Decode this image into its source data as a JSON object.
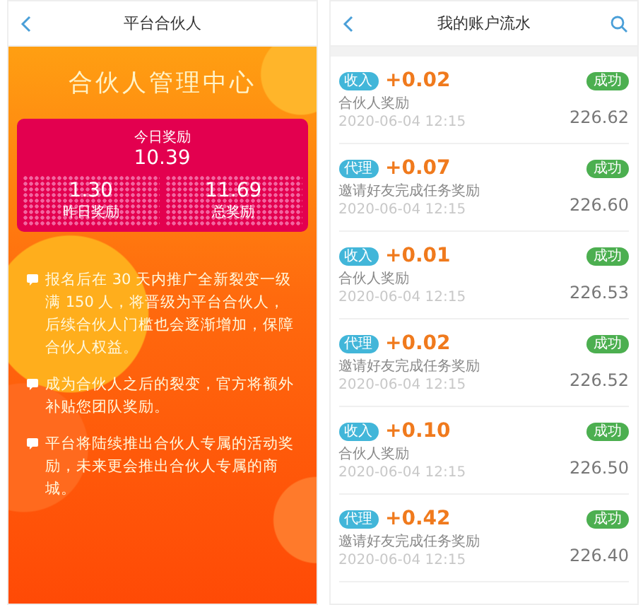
{
  "partner_screen": {
    "title": "平台合伙人",
    "heading": "合伙人管理中心",
    "today": {
      "label": "今日奖励",
      "value": "10.39"
    },
    "stats": [
      {
        "value": "1.30",
        "label": "昨日奖励"
      },
      {
        "value": "11.69",
        "label": "总奖励"
      }
    ],
    "notes": [
      "报名后在 30 天内推广全新裂变一级满 150 人，将晋级为平台合伙人，后续合伙人门槛也会逐渐增加，保障合伙人权益。",
      "成为合伙人之后的裂变，官方将额外补贴您团队奖励。",
      "平台将陆续推出合伙人专属的活动奖励，未来更会推出合伙人专属的商城。"
    ]
  },
  "ledger_screen": {
    "title": "我的账户流水",
    "entries": [
      {
        "tag": "收入",
        "amount": "+0.02",
        "status": "成功",
        "description": "合伙人奖励",
        "time": "2020-06-04 12:15",
        "balance": "226.62"
      },
      {
        "tag": "代理",
        "amount": "+0.07",
        "status": "成功",
        "description": "邀请好友完成任务奖励",
        "time": "2020-06-04 12:15",
        "balance": "226.60"
      },
      {
        "tag": "收入",
        "amount": "+0.01",
        "status": "成功",
        "description": "合伙人奖励",
        "time": "2020-06-04 12:15",
        "balance": "226.53"
      },
      {
        "tag": "代理",
        "amount": "+0.02",
        "status": "成功",
        "description": "邀请好友完成任务奖励",
        "time": "2020-06-04 12:15",
        "balance": "226.52"
      },
      {
        "tag": "收入",
        "amount": "+0.10",
        "status": "成功",
        "description": "合伙人奖励",
        "time": "2020-06-04 12:15",
        "balance": "226.50"
      },
      {
        "tag": "代理",
        "amount": "+0.42",
        "status": "成功",
        "description": "邀请好友完成任务奖励",
        "time": "2020-06-04 12:15",
        "balance": "226.40"
      }
    ]
  }
}
